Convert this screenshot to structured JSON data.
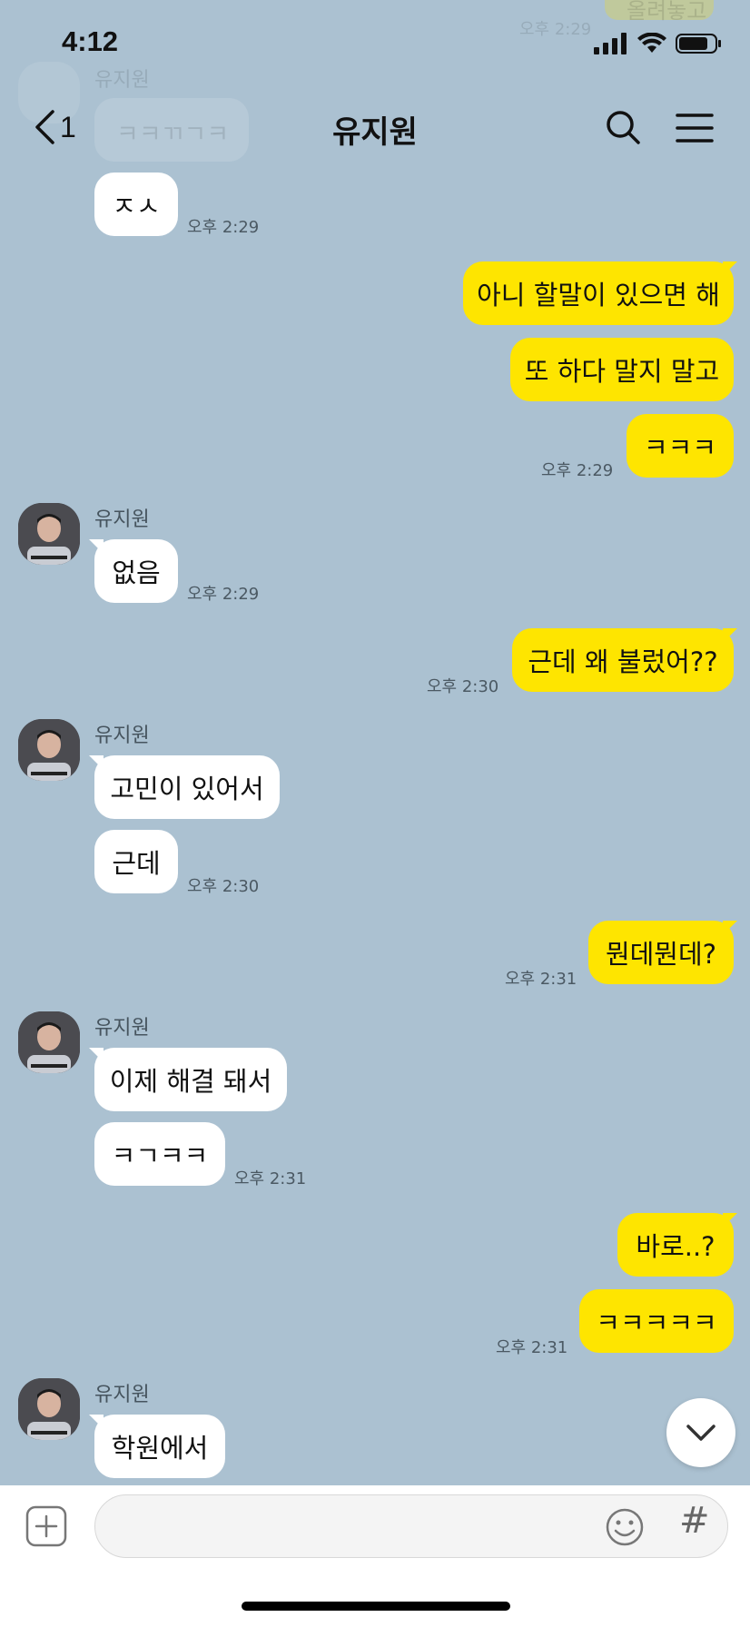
{
  "status": {
    "time": "4:12"
  },
  "header": {
    "back_count": "1",
    "title": "유지원"
  },
  "ghost_top": {
    "bubble": "ㅋㅋㄲㄱㅋ",
    "name": "유지원",
    "time": "오후 2:29",
    "sent_text": "올려놓고"
  },
  "messages": [
    {
      "side": "recv",
      "text": "ㅈㅅ",
      "time": "오후 2:29"
    },
    {
      "side": "sent",
      "text": "아니 할말이 있으면 해"
    },
    {
      "side": "sent",
      "text": "또 하다 말지 말고"
    },
    {
      "side": "sent",
      "text": "ㅋㅋㅋ",
      "time": "오후 2:29"
    },
    {
      "side": "recv",
      "name": "유지원",
      "text": "없음",
      "time": "오후 2:29"
    },
    {
      "side": "sent",
      "text": "근데 왜 불렀어??",
      "time": "오후 2:30"
    },
    {
      "side": "recv",
      "name": "유지원",
      "text": "고민이 있어서"
    },
    {
      "side": "recv",
      "text": "근데",
      "time": "오후 2:30"
    },
    {
      "side": "sent",
      "text": "뭔데뭔데?",
      "time": "오후 2:31"
    },
    {
      "side": "recv",
      "name": "유지원",
      "text": "이제 해결 돼서"
    },
    {
      "side": "recv",
      "text": "ㅋㄱㅋㅋ",
      "time": "오후 2:31"
    },
    {
      "side": "sent",
      "text": "바로..?"
    },
    {
      "side": "sent",
      "text": "ㅋㅋㅋㅋㅋ",
      "time": "오후 2:31"
    },
    {
      "side": "recv",
      "name": "유지원",
      "text": "학원에서"
    }
  ],
  "icons": {
    "back": "chevron-left-icon",
    "search": "search-icon",
    "menu": "menu-icon",
    "scroll": "chevron-down-icon",
    "plus": "plus-square-icon",
    "emoji": "emoji-icon",
    "hash": "#"
  },
  "colors": {
    "background": "#abc1d1",
    "sent_bubble": "#fee500",
    "recv_bubble": "#ffffff"
  }
}
